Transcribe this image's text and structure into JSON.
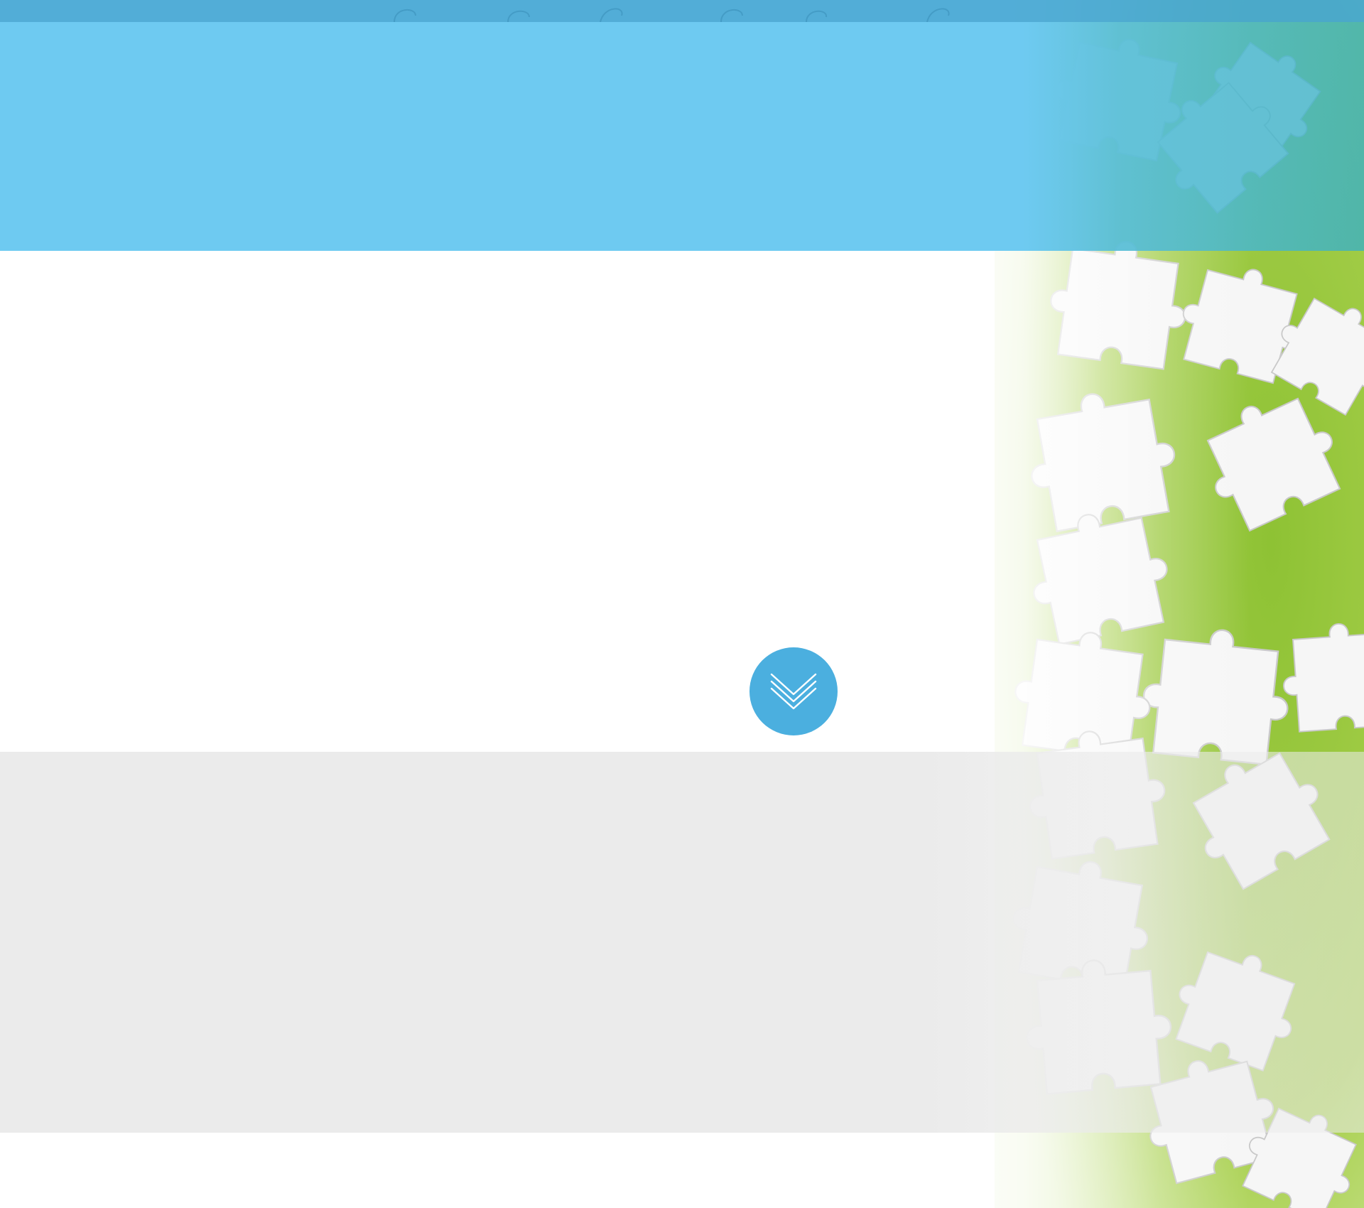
{
  "page": {
    "colors": {
      "top_strip": "#43a6d4",
      "hero_band": "#6ecaf1",
      "scroll_button": "#4bafdf",
      "grey_section": "#ebebeb",
      "puzzle_green": "#9cc93a",
      "puzzle_piece": "#f4f4f4"
    }
  },
  "hero": {
    "background_image": "puzzle-pieces"
  },
  "scroll_button": {
    "icon": "double-chevron-down-icon"
  }
}
